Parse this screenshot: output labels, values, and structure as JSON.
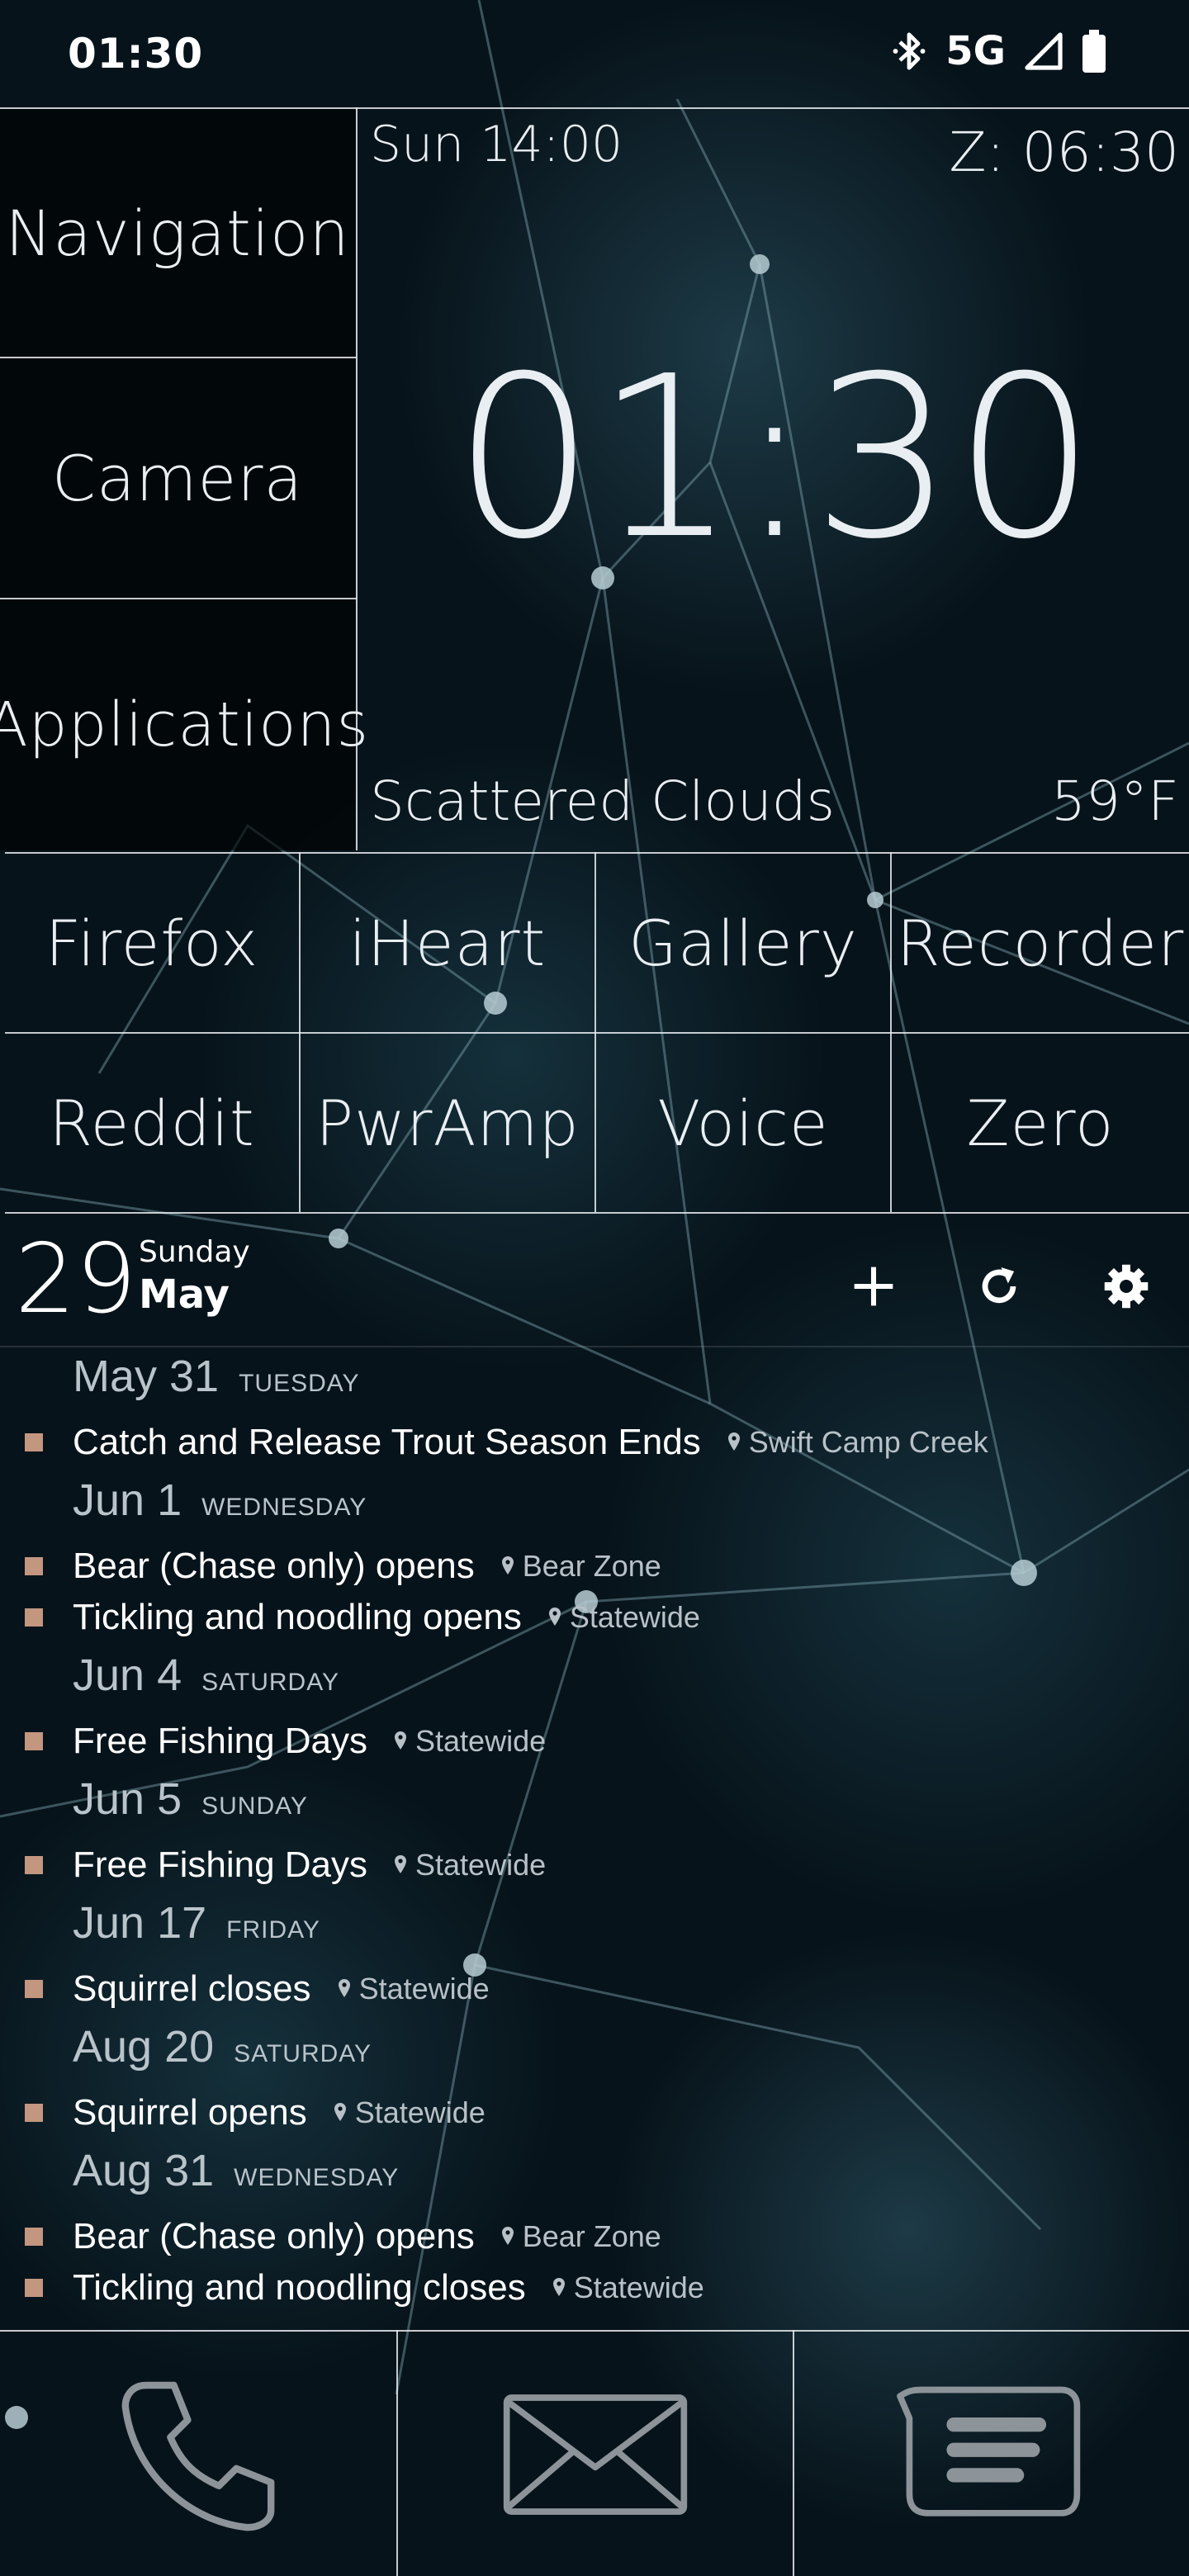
{
  "status_bar": {
    "time": "01:30",
    "network": "5G",
    "icons": [
      "bluetooth-icon",
      "signal-icon",
      "battery-icon"
    ]
  },
  "tiles": {
    "navigation": "Navigation",
    "camera": "Camera",
    "applications": "Applications"
  },
  "clock": {
    "next_day": "Sun 14:00",
    "alarm": "Z: 06:30",
    "time": "01:30",
    "weather": "Scattered Clouds",
    "temperature": "59°F"
  },
  "apps": [
    "Firefox",
    "iHeart",
    "Gallery",
    "Recorder",
    "Reddit",
    "PwrAmp",
    "Voice",
    "Zero"
  ],
  "calendar": {
    "day": "29",
    "weekday": "Sunday",
    "month": "May",
    "actions": [
      "add-icon",
      "refresh-icon",
      "settings-icon"
    ],
    "event_color": "#c39680",
    "days": [
      {
        "date": "May 31",
        "weekday": "TUESDAY",
        "events": [
          {
            "title": "Catch and Release Trout Season Ends",
            "location": "Swift Camp Creek"
          }
        ]
      },
      {
        "date": "Jun 1",
        "weekday": "WEDNESDAY",
        "events": [
          {
            "title": "Bear (Chase only) opens",
            "location": "Bear Zone"
          },
          {
            "title": "Tickling and noodling opens",
            "location": "Statewide"
          }
        ]
      },
      {
        "date": "Jun 4",
        "weekday": "SATURDAY",
        "events": [
          {
            "title": "Free Fishing Days",
            "location": "Statewide"
          }
        ]
      },
      {
        "date": "Jun 5",
        "weekday": "SUNDAY",
        "events": [
          {
            "title": "Free Fishing Days",
            "location": "Statewide"
          }
        ]
      },
      {
        "date": "Jun 17",
        "weekday": "FRIDAY",
        "events": [
          {
            "title": "Squirrel closes",
            "location": "Statewide"
          }
        ]
      },
      {
        "date": "Aug 20",
        "weekday": "SATURDAY",
        "events": [
          {
            "title": "Squirrel opens",
            "location": "Statewide"
          }
        ]
      },
      {
        "date": "Aug 31",
        "weekday": "WEDNESDAY",
        "events": [
          {
            "title": "Bear (Chase only) opens",
            "location": "Bear Zone"
          },
          {
            "title": "Tickling and noodling closes",
            "location": "Statewide"
          }
        ]
      }
    ]
  },
  "dock": [
    "phone-icon",
    "mail-icon",
    "messages-icon"
  ]
}
